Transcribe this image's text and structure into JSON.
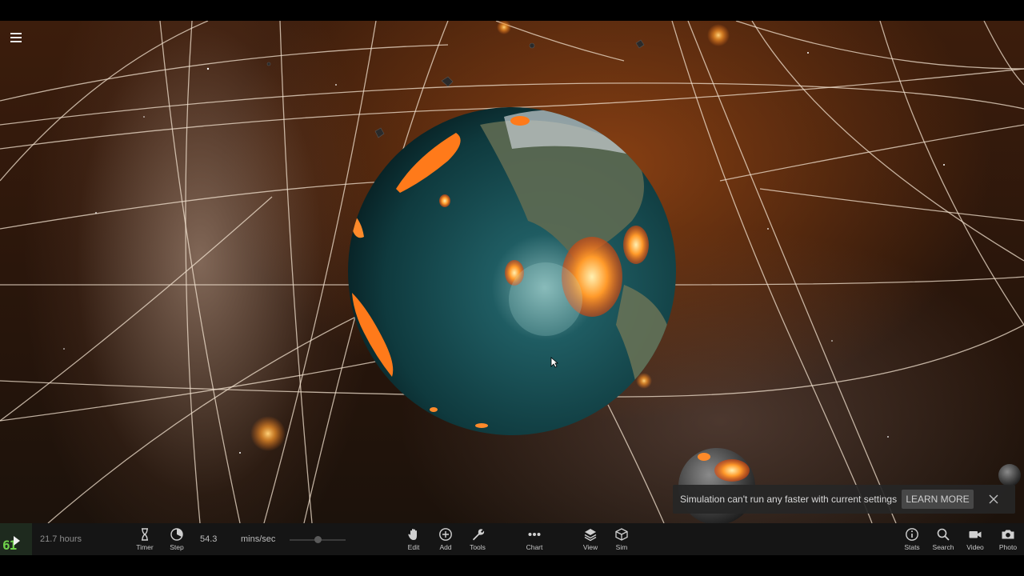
{
  "toolbar": {
    "fps": "61",
    "sim_time": "21.7 hours",
    "rate_value": "54.3",
    "rate_unit": "mins/sec",
    "rate_slider_fraction": 0.5,
    "tools": {
      "timer": "Timer",
      "step": "Step",
      "edit": "Edit",
      "add": "Add",
      "tools": "Tools",
      "chart": "Chart",
      "view": "View",
      "sim": "Sim",
      "stats": "Stats",
      "search": "Search",
      "video": "Video",
      "photo": "Photo"
    }
  },
  "notification": {
    "message": "Simulation can't run any faster with current settings",
    "learn_more": "LEARN MORE"
  },
  "icons": {
    "menu": "hamburger-menu-icon",
    "play": "play-icon",
    "timer": "hourglass-icon",
    "step": "step-dial-icon",
    "edit": "hand-icon",
    "add": "plus-circle-icon",
    "tools": "wrench-icon",
    "chart": "dots-icon",
    "view": "layers-icon",
    "sim": "cube-icon",
    "stats": "info-icon",
    "search": "search-icon",
    "video": "video-camera-icon",
    "photo": "camera-icon",
    "close": "close-icon"
  },
  "colors": {
    "fps_green": "#6fd24a",
    "toolbar_bg": "#151515",
    "toast_bg": "#262626",
    "space_bg": "#2a160b",
    "planet_ocean": "#123c40",
    "impact_fire": "#ff7a1a"
  }
}
